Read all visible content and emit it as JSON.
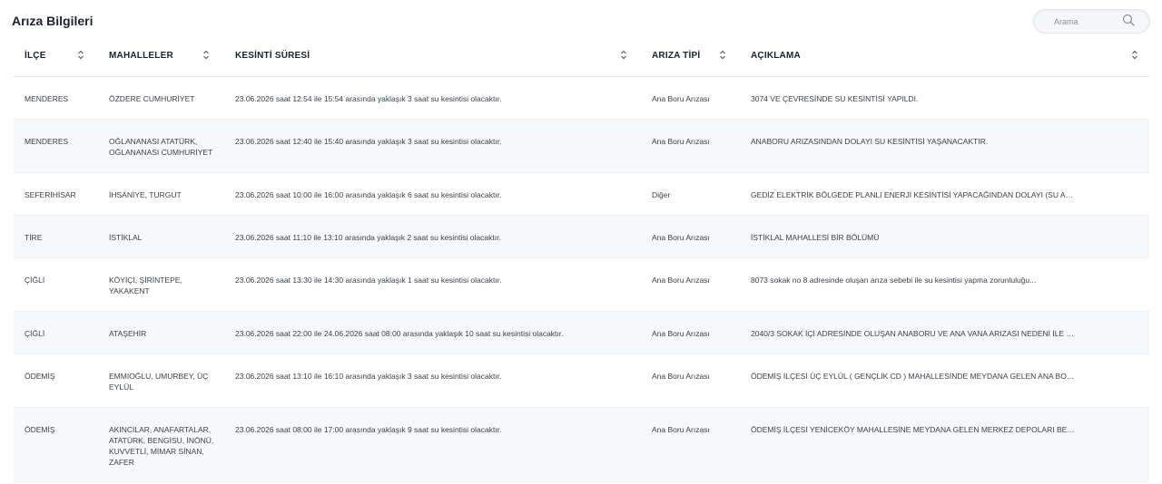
{
  "page": {
    "title": "Arıza Bilgileri"
  },
  "search": {
    "placeholder": "Arama"
  },
  "columns": [
    {
      "label": "İLÇE"
    },
    {
      "label": "MAHALLELER"
    },
    {
      "label": "KESİNTİ SÜRESİ"
    },
    {
      "label": "ARIZA TİPİ"
    },
    {
      "label": "AÇIKLAMA"
    }
  ],
  "rows": [
    {
      "ilce": "MENDERES",
      "mahalleler": "ÖZDERE CUMHURİYET",
      "kesinti": "23.06.2026 saat 12:54 ile 15:54 arasında yaklaşık 3 saat su kesintisi olacaktır.",
      "tip": "Ana Boru Arızası",
      "aciklama": "3074 VE ÇEVRESİNDE SU KESİNTİSİ YAPILDI."
    },
    {
      "ilce": "MENDERES",
      "mahalleler": "OĞLANANASI ATATÜRK, OĞLANANASI CUMHURİYET",
      "kesinti": "23.06.2026 saat 12:40 ile 15:40 arasında yaklaşık 3 saat su kesintisi olacaktır.",
      "tip": "Ana Boru Arızası",
      "aciklama": "ANABORU ARIZASINDAN DOLAYI SU KESİNTİSİ YAŞANACAKTIR."
    },
    {
      "ilce": "SEFERİHİSAR",
      "mahalleler": "İHSANİYE, TURGUT",
      "kesinti": "23.06.2026 saat 10:00 ile 16:00 arasında yaklaşık 6 saat su kesintisi olacaktır.",
      "tip": "Diğer",
      "aciklama": "GEDİZ ELEKTRİK BÖLGEDE PLANLI ENERJİ KESİNTİSİ YAPACAĞINDAN DOLAYI (SU AKMIYOR /..."
    },
    {
      "ilce": "TİRE",
      "mahalleler": "İSTİKLAL",
      "kesinti": "23.06.2026 saat 11:10 ile 13:10 arasında yaklaşık 2 saat su kesintisi olacaktır.",
      "tip": "Ana Boru Arızası",
      "aciklama": "İSTİKLAL MAHALLESİ BİR BÖLÜMÜ"
    },
    {
      "ilce": "ÇİĞLİ",
      "mahalleler": "KÖYİÇİ, ŞİRİNTEPE, YAKAKENT",
      "kesinti": "23.06.2026 saat 13:30 ile 14:30 arasında yaklaşık 1 saat su kesintisi olacaktır.",
      "tip": "Ana Boru Arızası",
      "aciklama": "8073 sokak no 8 adresinde oluşan arıza sebebi ile su kesintisi yapma zorunluluğu..."
    },
    {
      "ilce": "ÇİĞLİ",
      "mahalleler": "ATAŞEHİR",
      "kesinti": "23.06.2026 saat 22:00 ile 24.06.2026 saat 08:00 arasında yaklaşık 10 saat su kesintisi olacaktır.",
      "tip": "Ana Boru Arızası",
      "aciklama": "2040/3 SOKAK İÇİ ADRESİNDE OLUŞAN ANABORU VE ANA VANA ARIZASI NEDENİ İLE SU KESİ..."
    },
    {
      "ilce": "ÖDEMİŞ",
      "mahalleler": "EMMIOĞLU, UMURBEY, ÜÇ EYLÜL",
      "kesinti": "23.06.2026 saat 13:10 ile 16:10 arasında yaklaşık 3 saat su kesintisi olacaktır.",
      "tip": "Ana Boru Arızası",
      "aciklama": "ÖDEMİŞ İLÇESİ ÜÇ EYLÜL ( GENÇLİK CD ) MAHALLESİNDE MEYDANA GELEN ANA BORU ARIZAS..."
    },
    {
      "ilce": "ÖDEMİŞ",
      "mahalleler": "AKINCILAR, ANAFARTALAR, ATATÜRK, BENGİSU, İNÖNÜ, KUVVETLİ, MİMAR SİNAN, ZAFER",
      "kesinti": "23.06.2026 saat 08:00 ile 17:00 arasında yaklaşık 9 saat su kesintisi olacaktır.",
      "tip": "Ana Boru Arızası",
      "aciklama": "ÖDEMİŞ İLÇESİ YENİCEKÖY MAHALLESİNE MEYDANA GELEN MERKEZ DEPOLARI BESLEYEN ANA..."
    }
  ]
}
